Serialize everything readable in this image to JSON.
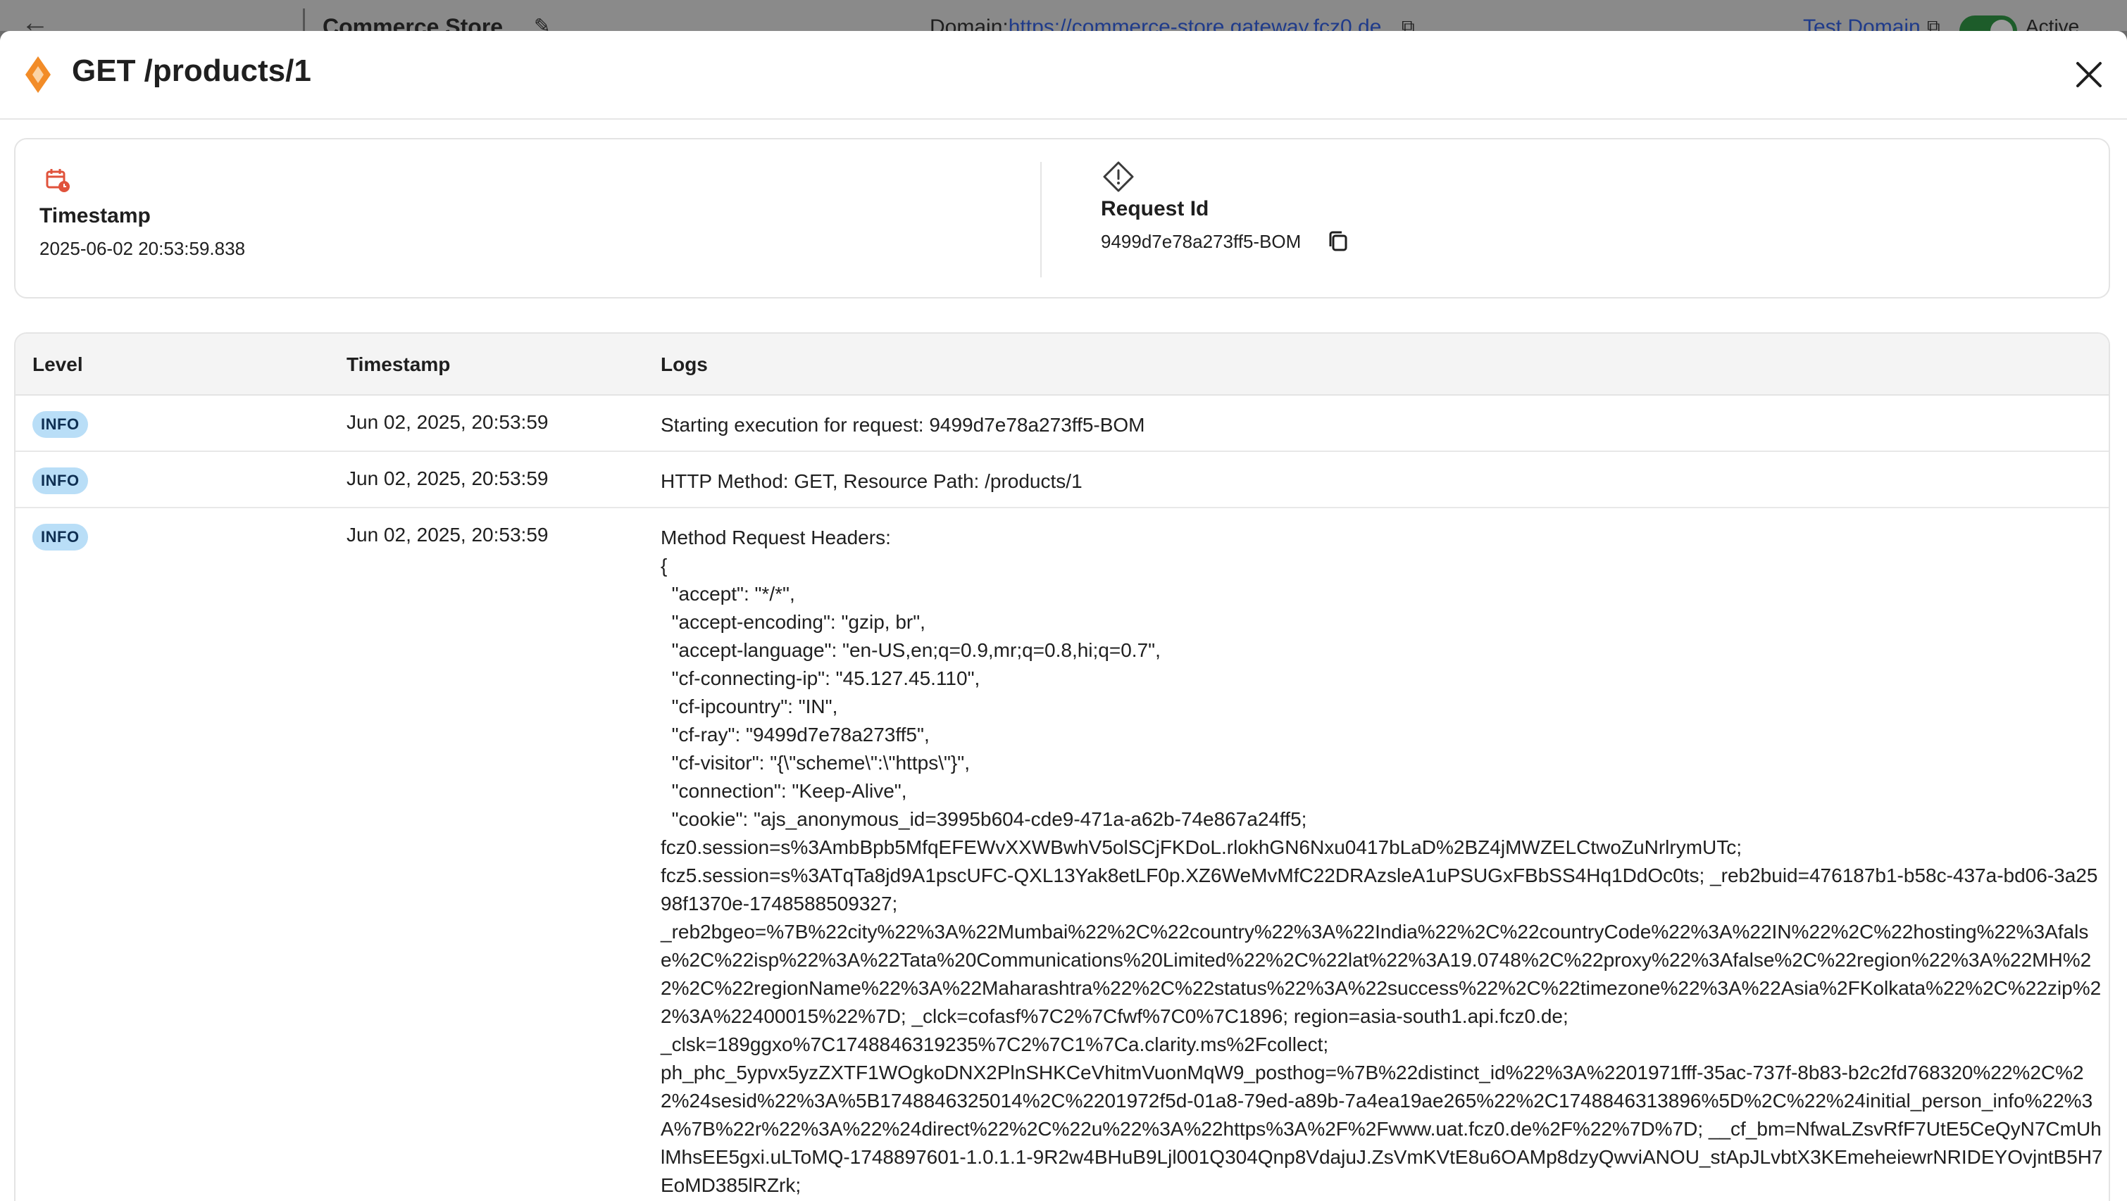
{
  "background": {
    "back_icon": "←",
    "store_name": "Commerce Store",
    "edit_icon": "✎",
    "domain_label": "Domain:",
    "domain_url": "https://commerce-store.gateway.fcz0.de",
    "test_domain": "Test Domain",
    "status": "Active"
  },
  "modal": {
    "title": "GET /products/1",
    "accent": "#f28c28"
  },
  "summary": {
    "timestamp_label": "Timestamp",
    "timestamp_value": "2025-06-02 20:53:59.838",
    "request_id_label": "Request Id",
    "request_id_value": "9499d7e78a273ff5-BOM"
  },
  "logs": {
    "headers": {
      "level": "Level",
      "timestamp": "Timestamp",
      "logs": "Logs"
    },
    "rows": [
      {
        "level": "INFO",
        "timestamp": "Jun 02, 2025, 20:53:59",
        "message": "Starting execution for request: 9499d7e78a273ff5-BOM"
      },
      {
        "level": "INFO",
        "timestamp": "Jun 02, 2025, 20:53:59",
        "message": "HTTP Method: GET, Resource Path: /products/1"
      },
      {
        "level": "INFO",
        "timestamp": "Jun 02, 2025, 20:53:59",
        "message": "Method Request Headers:\n{\n  \"accept\": \"*/*\",\n  \"accept-encoding\": \"gzip, br\",\n  \"accept-language\": \"en-US,en;q=0.9,mr;q=0.8,hi;q=0.7\",\n  \"cf-connecting-ip\": \"45.127.45.110\",\n  \"cf-ipcountry\": \"IN\",\n  \"cf-ray\": \"9499d7e78a273ff5\",\n  \"cf-visitor\": \"{\\\"scheme\\\":\\\"https\\\"}\",\n  \"connection\": \"Keep-Alive\",\n  \"cookie\": \"ajs_anonymous_id=3995b604-cde9-471a-a62b-74e867a24ff5;\nfcz0.session=s%3AmbBpb5MfqEFEWvXXWBwhV5olSCjFKDoL.rlokhGN6Nxu0417bLaD%2BZ4jMWZELCtwoZuNrlrymUTc;\nfcz5.session=s%3ATqTa8jd9A1pscUFC-QXL13Yak8etLF0p.XZ6WeMvMfC22DRAzsleA1uPSUGxFBbSS4Hq1DdOc0ts; _reb2buid=476187b1-b58c-437a-bd06-3a2598f1370e-1748588509327;\n_reb2bgeo=%7B%22city%22%3A%22Mumbai%22%2C%22country%22%3A%22India%22%2C%22countryCode%22%3A%22IN%22%2C%22hosting%22%3Afalse%2C%22isp%22%3A%22Tata%20Communications%20Limited%22%2C%22lat%22%3A19.0748%2C%22proxy%22%3Afalse%2C%22region%22%3A%22MH%22%2C%22regionName%22%3A%22Maharashtra%22%2C%22status%22%3A%22success%22%2C%22timezone%22%3A%22Asia%2FKolkata%22%2C%22zip%22%3A%22400015%22%7D; _clck=cofasf%7C2%7Cfwf%7C0%7C1896; region=asia-south1.api.fcz0.de;\n_clsk=189ggxo%7C1748846319235%7C2%7C1%7Ca.clarity.ms%2Fcollect;\nph_phc_5ypvx5yzZXTF1WOgkoDNX2PlnSHKCeVhitmVuonMqW9_posthog=%7B%22distinct_id%22%3A%2201971fff-35ac-737f-8b83-b2c2fd768320%22%2C%22%24sesid%22%3A%5B1748846325014%2C%2201972f5d-01a8-79ed-a89b-7a4ea19ae265%22%2C1748846313896%5D%2C%22%24initial_person_info%22%3A%7B%22r%22%3A%22%24direct%22%2C%22u%22%3A%22https%3A%2F%2Fwww.uat.fcz0.de%2F%22%7D%7D; __cf_bm=NfwaLZsvRfF7UtE5CeQyN7CmUhlMhsEE5gxi.uLToMQ-1748897601-1.0.1.1-9R2w4BHuB9Ljl001Q304Qnp8VdajuJ.ZsVmKVtE8u6OAMp8dzyQwviANOU_stApJLvbtX3KEmeheiewrNRIDEYOvjntB5H7EoMD385lRZrk;"
      }
    ]
  }
}
